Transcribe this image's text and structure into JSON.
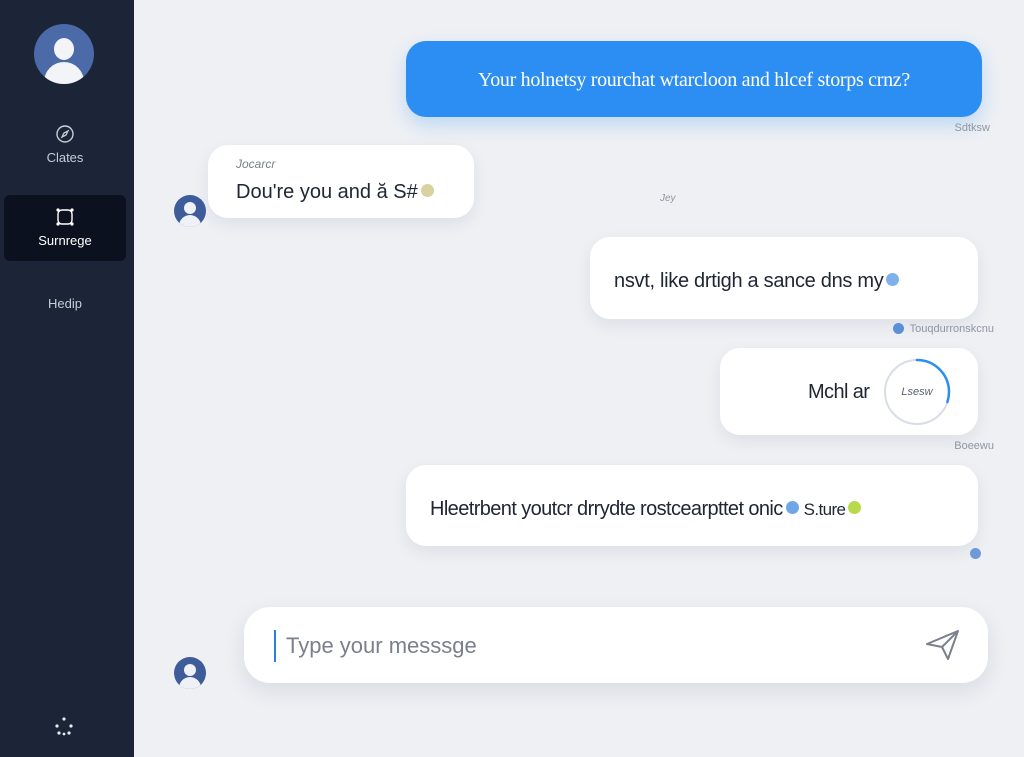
{
  "sidebar": {
    "items": [
      {
        "label": "Clates",
        "icon": "compass-icon",
        "active": false
      },
      {
        "label": "Surnrege",
        "icon": "frame-icon",
        "active": true
      },
      {
        "label": "Hedip",
        "icon": "",
        "active": false
      }
    ],
    "settings_icon": "settings-dots-icon"
  },
  "messages": [
    {
      "side": "sent",
      "style": "blue",
      "text": "Your holnetsy rourchat wtarcloon and hlcef storps crnz?",
      "timestamp": "Sdtksw"
    },
    {
      "side": "received",
      "sender": "Jocarcr",
      "text": "Dou're you and ă S#",
      "timestamp": "Jey"
    },
    {
      "side": "sent",
      "text": "nsvt, like drtigh a sance dns my",
      "timestamp": "Touqdurronskcnu"
    },
    {
      "side": "sent",
      "text": "Mchl ar",
      "gauge_label": "Lsesw",
      "gauge_progress": 0.3,
      "timestamp": "Boeewu"
    },
    {
      "side": "sent",
      "text": "Hleetrbent youtcr drrydte rostcearpttet onic",
      "suffix": "S.ture"
    }
  ],
  "composer": {
    "placeholder": "Type your messsge",
    "value": ""
  },
  "colors": {
    "sidebar_bg": "#1c2437",
    "accent": "#2c8ef2",
    "page_bg": "#eef0f4"
  }
}
